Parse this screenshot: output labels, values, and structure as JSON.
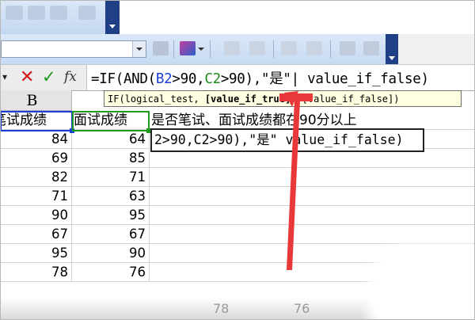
{
  "formula_bar": {
    "name_box_arrow": "▾",
    "cancel_icon": "cancel-icon",
    "enter_icon": "enter-icon",
    "fx_icon": "fx-icon",
    "fx_label": "fx",
    "formula_prefix": "=IF(AND(",
    "ref_b": "B2",
    "mid1": ">90,",
    "ref_c": "C2",
    "mid2": ">90),\"是\"",
    "cursor": "|",
    "formula_suffix": " value_if_false)"
  },
  "tooltip": {
    "prefix": "IF(logical_test, ",
    "bold_arg": "[value_if_true]",
    "suffix": ", [value_if_false])"
  },
  "columns": {
    "b_header": "B"
  },
  "header_row": {
    "b": "笔试成绩",
    "c": "面试成绩",
    "d": "是否笔试、面试成绩都在90分以上"
  },
  "editing_cell": {
    "text": "2>90,C2>90),\"是\" value_if_false)"
  },
  "rows": [
    {
      "b": "84",
      "c": "64"
    },
    {
      "b": "69",
      "c": "85"
    },
    {
      "b": "82",
      "c": "71"
    },
    {
      "b": "71",
      "c": "63"
    },
    {
      "b": "90",
      "c": "95"
    },
    {
      "b": "67",
      "c": "67"
    },
    {
      "b": "95",
      "c": "90"
    },
    {
      "b": "78",
      "c": "76"
    }
  ],
  "ghost_values": {
    "b": "78",
    "c": "76"
  },
  "colors": {
    "ref_b": "#1c3ed8",
    "ref_c": "#1e8a1e",
    "arrow": "#e8383a",
    "tooltip_bg": "#ffffe1"
  }
}
